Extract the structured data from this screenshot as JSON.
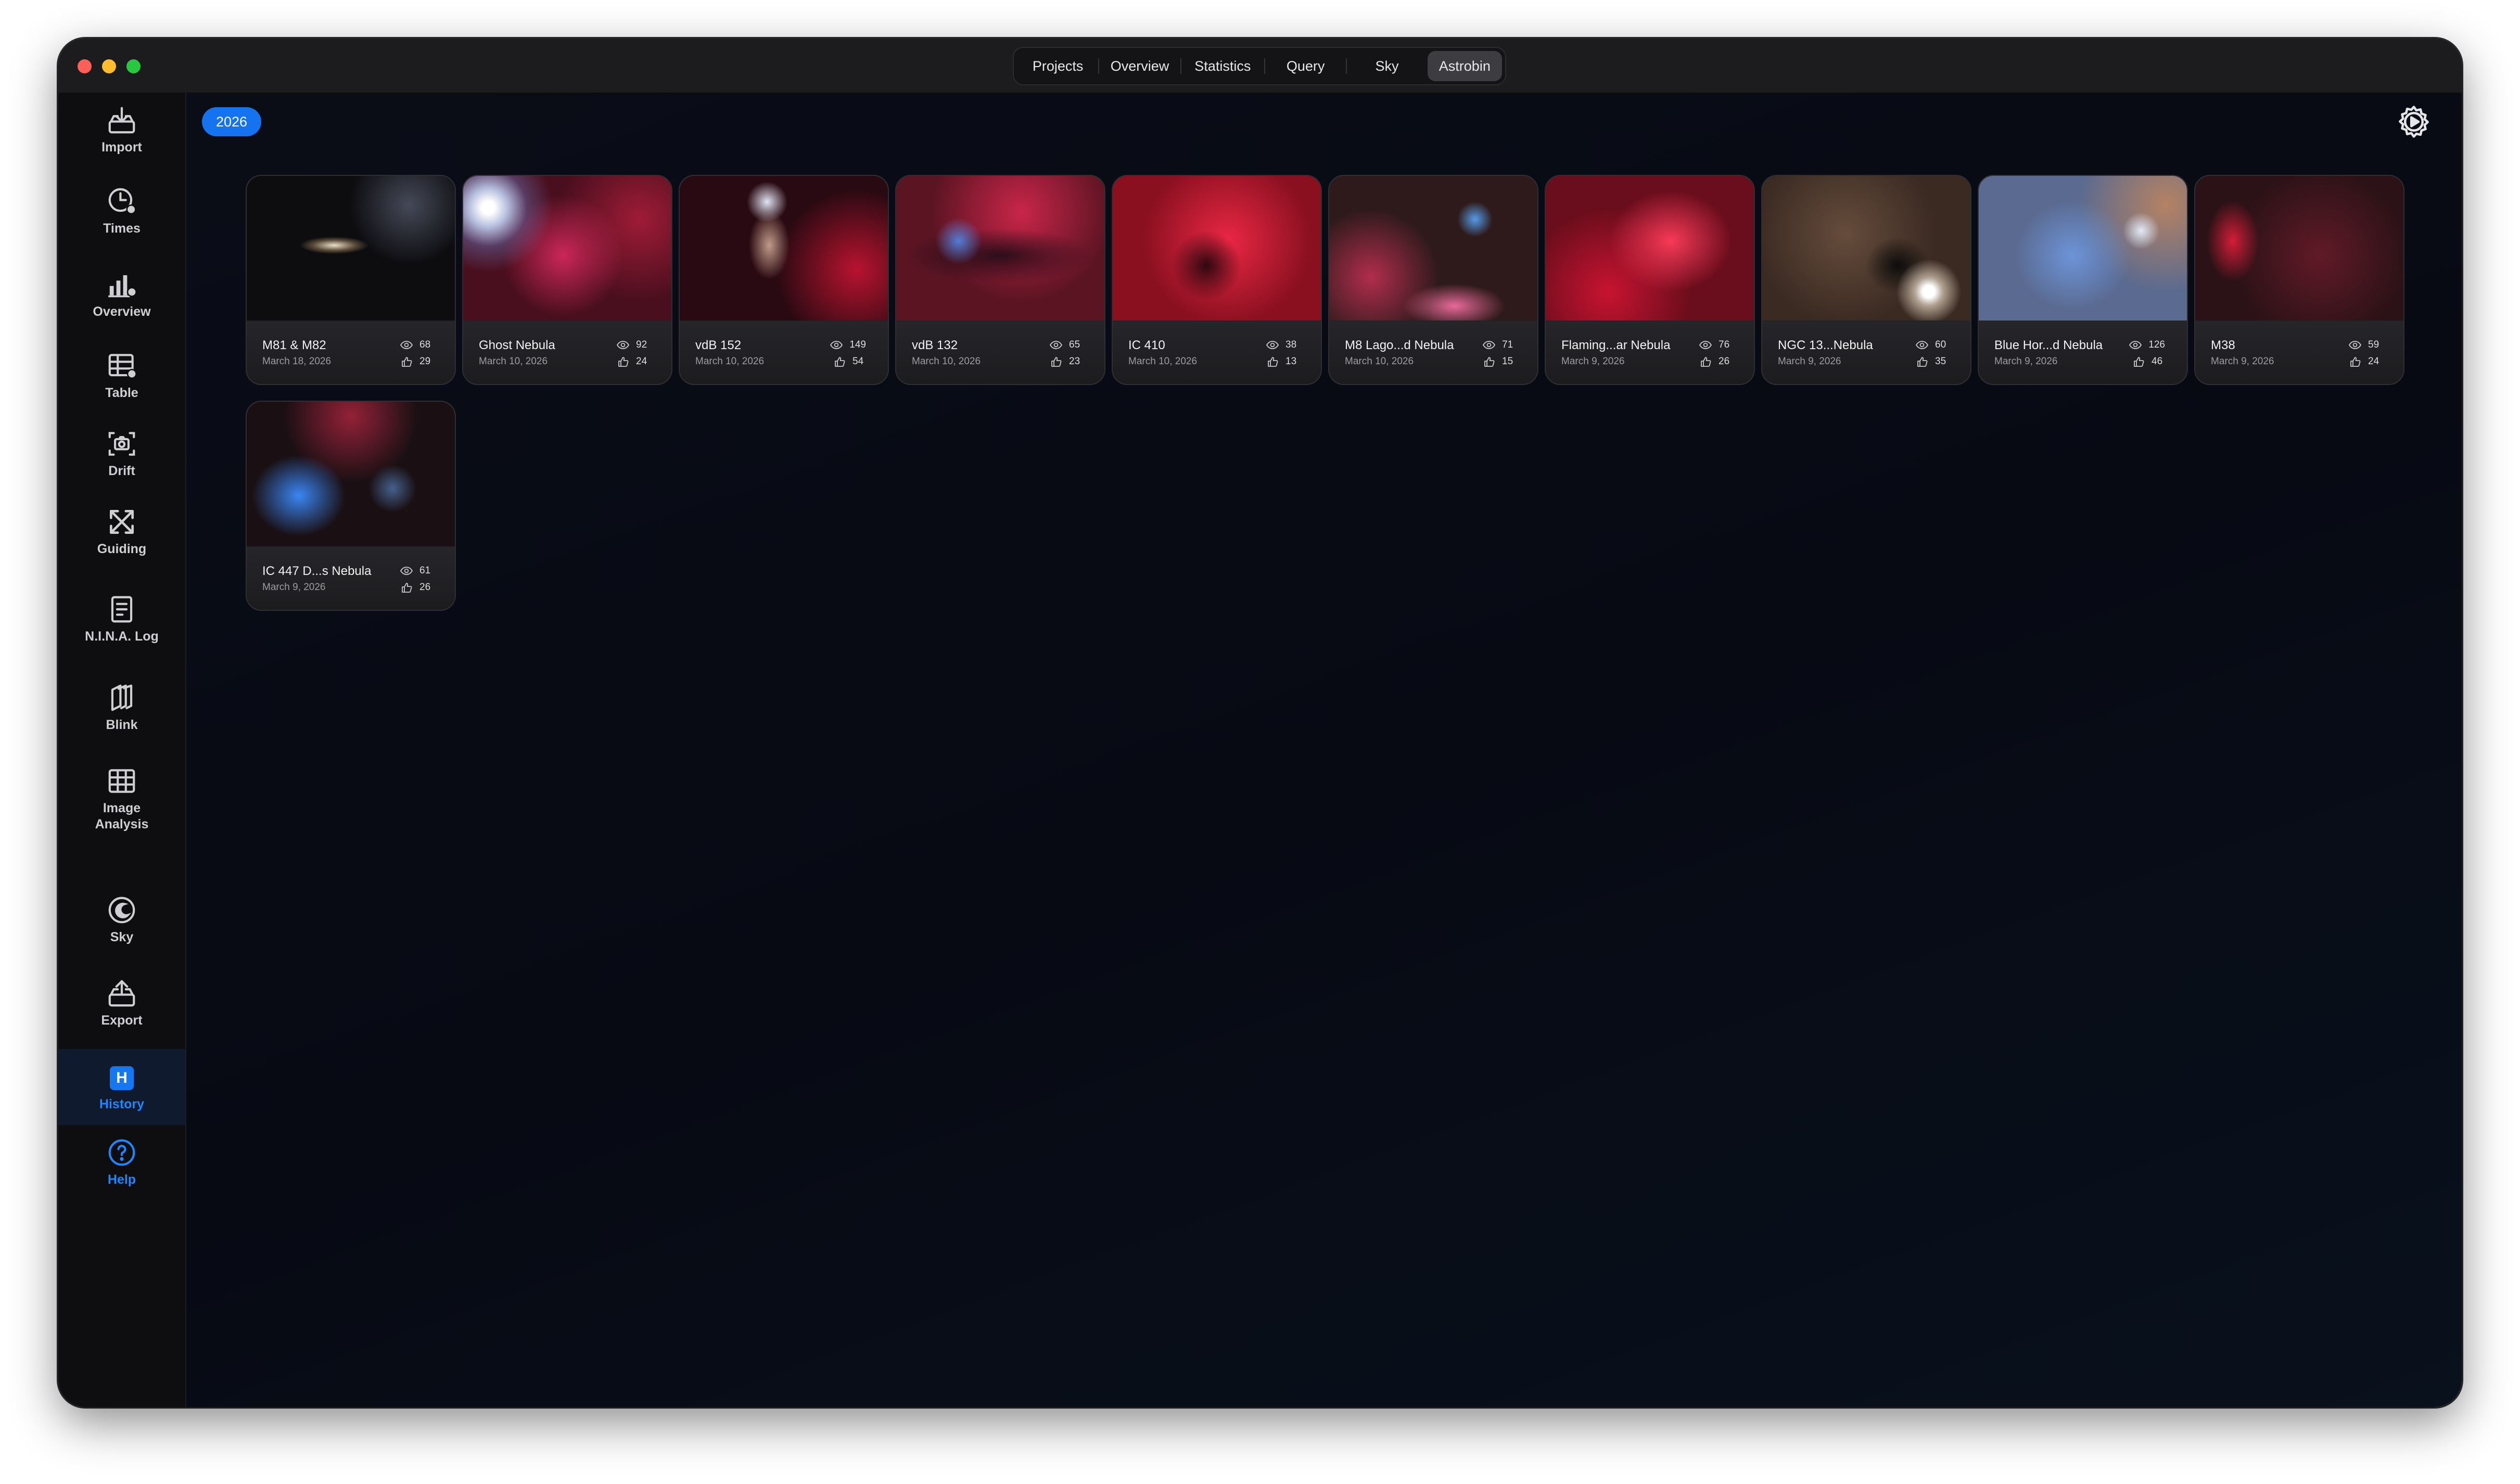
{
  "window": {
    "nav_tabs": [
      {
        "label": "Projects",
        "active": false
      },
      {
        "label": "Overview",
        "active": false
      },
      {
        "label": "Statistics",
        "active": false
      },
      {
        "label": "Query",
        "active": false
      },
      {
        "label": "Sky",
        "active": false
      },
      {
        "label": "Astrobin",
        "active": true
      }
    ]
  },
  "sidebar": {
    "items": [
      {
        "label": "Import",
        "icon": "import-icon"
      },
      {
        "label": "Times",
        "icon": "clock-icon"
      },
      {
        "label": "Overview",
        "icon": "bar-chart-icon"
      },
      {
        "label": "Table",
        "icon": "table-icon"
      },
      {
        "label": "Drift",
        "icon": "camera-drift-icon"
      },
      {
        "label": "Guiding",
        "icon": "guiding-arrows-icon"
      },
      {
        "label": "N.I.N.A. Log",
        "icon": "document-icon"
      },
      {
        "label": "Blink",
        "icon": "layers-icon"
      },
      {
        "label": "Image Analysis",
        "icon": "grid-icon"
      },
      {
        "label": "Sky",
        "icon": "moon-icon"
      },
      {
        "label": "Export",
        "icon": "export-icon"
      },
      {
        "label": "History",
        "icon": "history-h-icon",
        "badge": "H",
        "active": true
      },
      {
        "label": "Help",
        "icon": "help-icon"
      }
    ]
  },
  "main": {
    "year_filter": "2026",
    "settings_icon": "gear-icon",
    "cards": [
      {
        "title": "M81 & M82",
        "date": "March 18, 2026",
        "views": "68",
        "likes": "29"
      },
      {
        "title": "Ghost Nebula",
        "date": "March 10, 2026",
        "views": "92",
        "likes": "24"
      },
      {
        "title": "vdB 152",
        "date": "March 10, 2026",
        "views": "149",
        "likes": "54"
      },
      {
        "title": "vdB 132",
        "date": "March 10, 2026",
        "views": "65",
        "likes": "23"
      },
      {
        "title": "IC 410",
        "date": "March 10, 2026",
        "views": "38",
        "likes": "13"
      },
      {
        "title": "M8 Lago...d Nebula",
        "date": "March 10, 2026",
        "views": "71",
        "likes": "15"
      },
      {
        "title": "Flaming...ar Nebula",
        "date": "March 9, 2026",
        "views": "76",
        "likes": "26"
      },
      {
        "title": "NGC 13...Nebula",
        "date": "March 9, 2026",
        "views": "60",
        "likes": "35"
      },
      {
        "title": "Blue Hor...d Nebula",
        "date": "March 9, 2026",
        "views": "126",
        "likes": "46"
      },
      {
        "title": "M38",
        "date": "March 9, 2026",
        "views": "59",
        "likes": "24"
      },
      {
        "title": "IC 447 D...s Nebula",
        "date": "March 9, 2026",
        "views": "61",
        "likes": "26"
      }
    ]
  },
  "colors": {
    "accent": "#1673f0",
    "background": "#070a13",
    "sidebar": "#0e0e10"
  }
}
